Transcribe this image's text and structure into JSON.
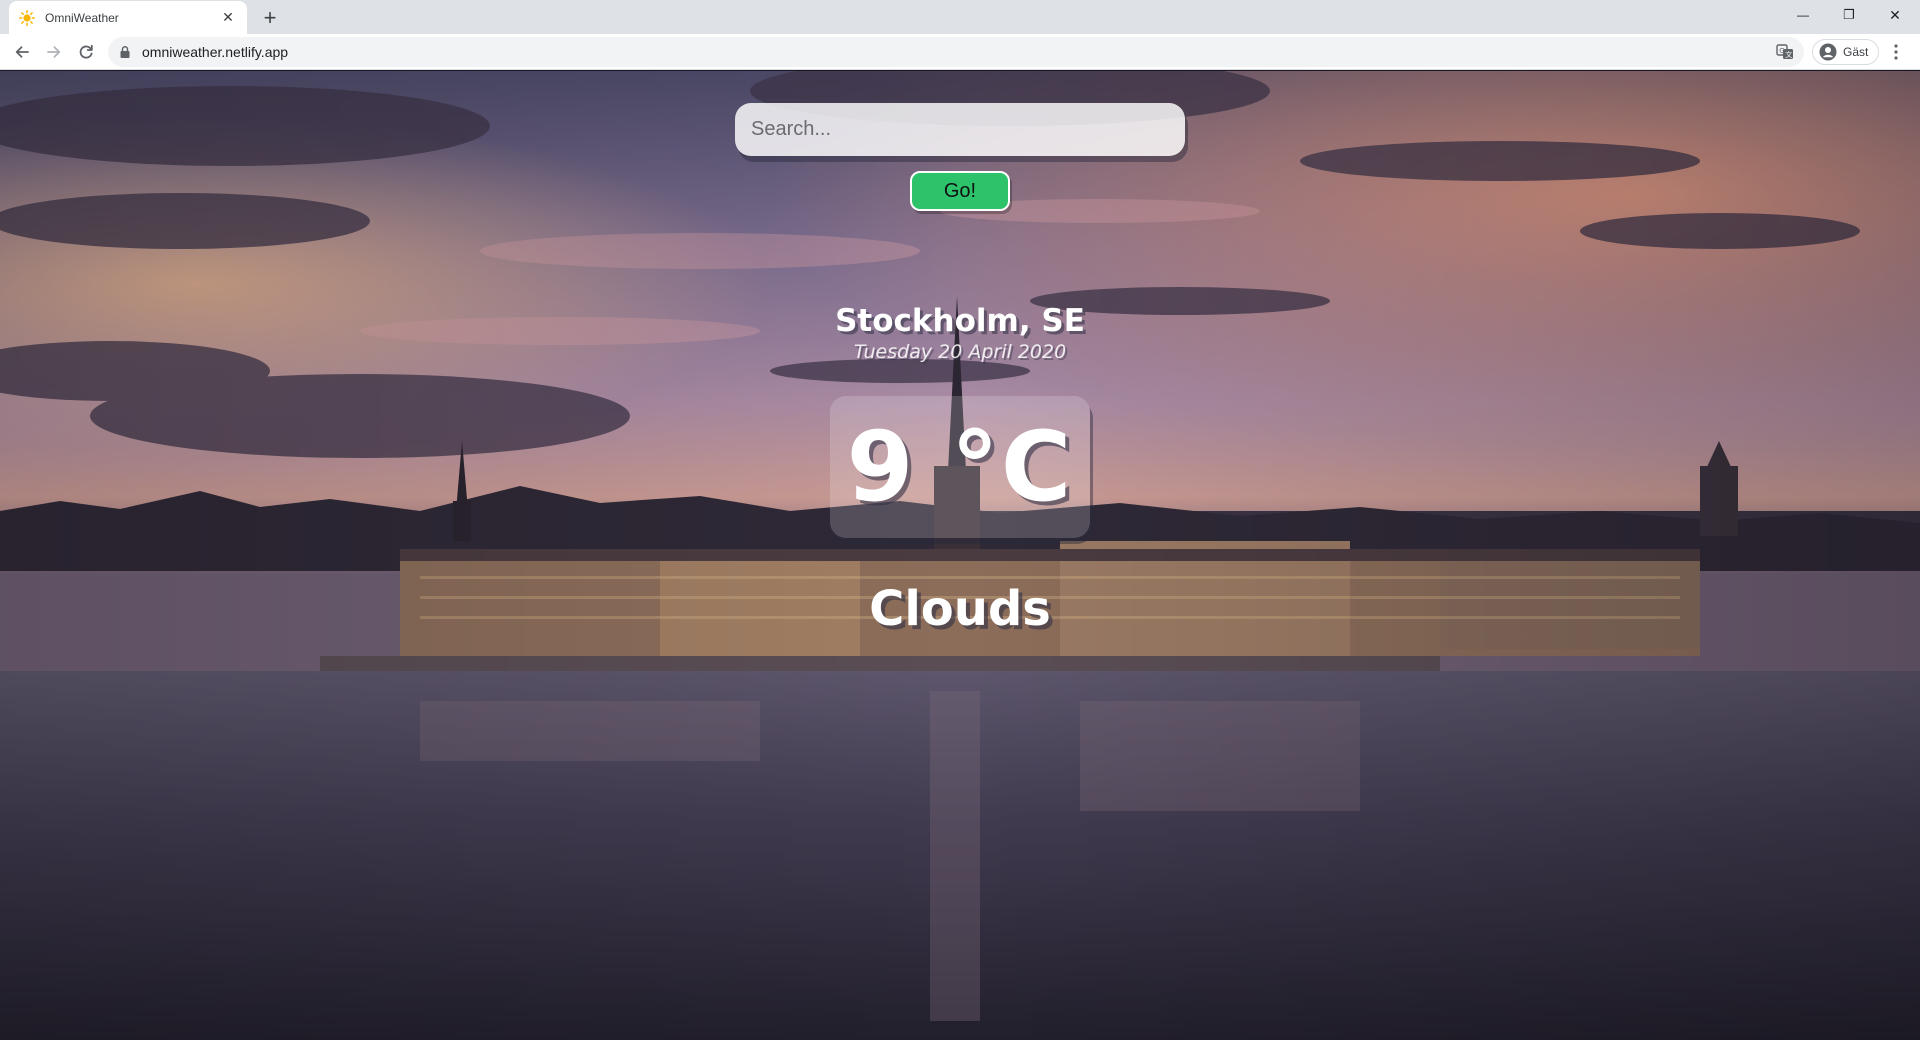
{
  "browser": {
    "tab_title": "OmniWeather",
    "tab_close": "✕",
    "new_tab": "+",
    "url": "omniweather.netlify.app",
    "profile_name": "Gäst",
    "window_controls": {
      "minimize": "—",
      "restore": "❐",
      "close": "✕"
    },
    "icons": [
      "sun-favicon-icon",
      "back-arrow-icon",
      "forward-arrow-icon",
      "reload-icon",
      "lock-icon",
      "translate-icon",
      "avatar-icon",
      "menu-dots-icon"
    ]
  },
  "app": {
    "search": {
      "placeholder": "Search...",
      "value": ""
    },
    "go_label": "Go!",
    "location": "Stockholm, SE",
    "date": "Tuesday 20 April 2020",
    "temperature": "9 °C",
    "condition": "Clouds"
  },
  "colors": {
    "go_button": "#2cc36b",
    "text": "#ffffff"
  }
}
